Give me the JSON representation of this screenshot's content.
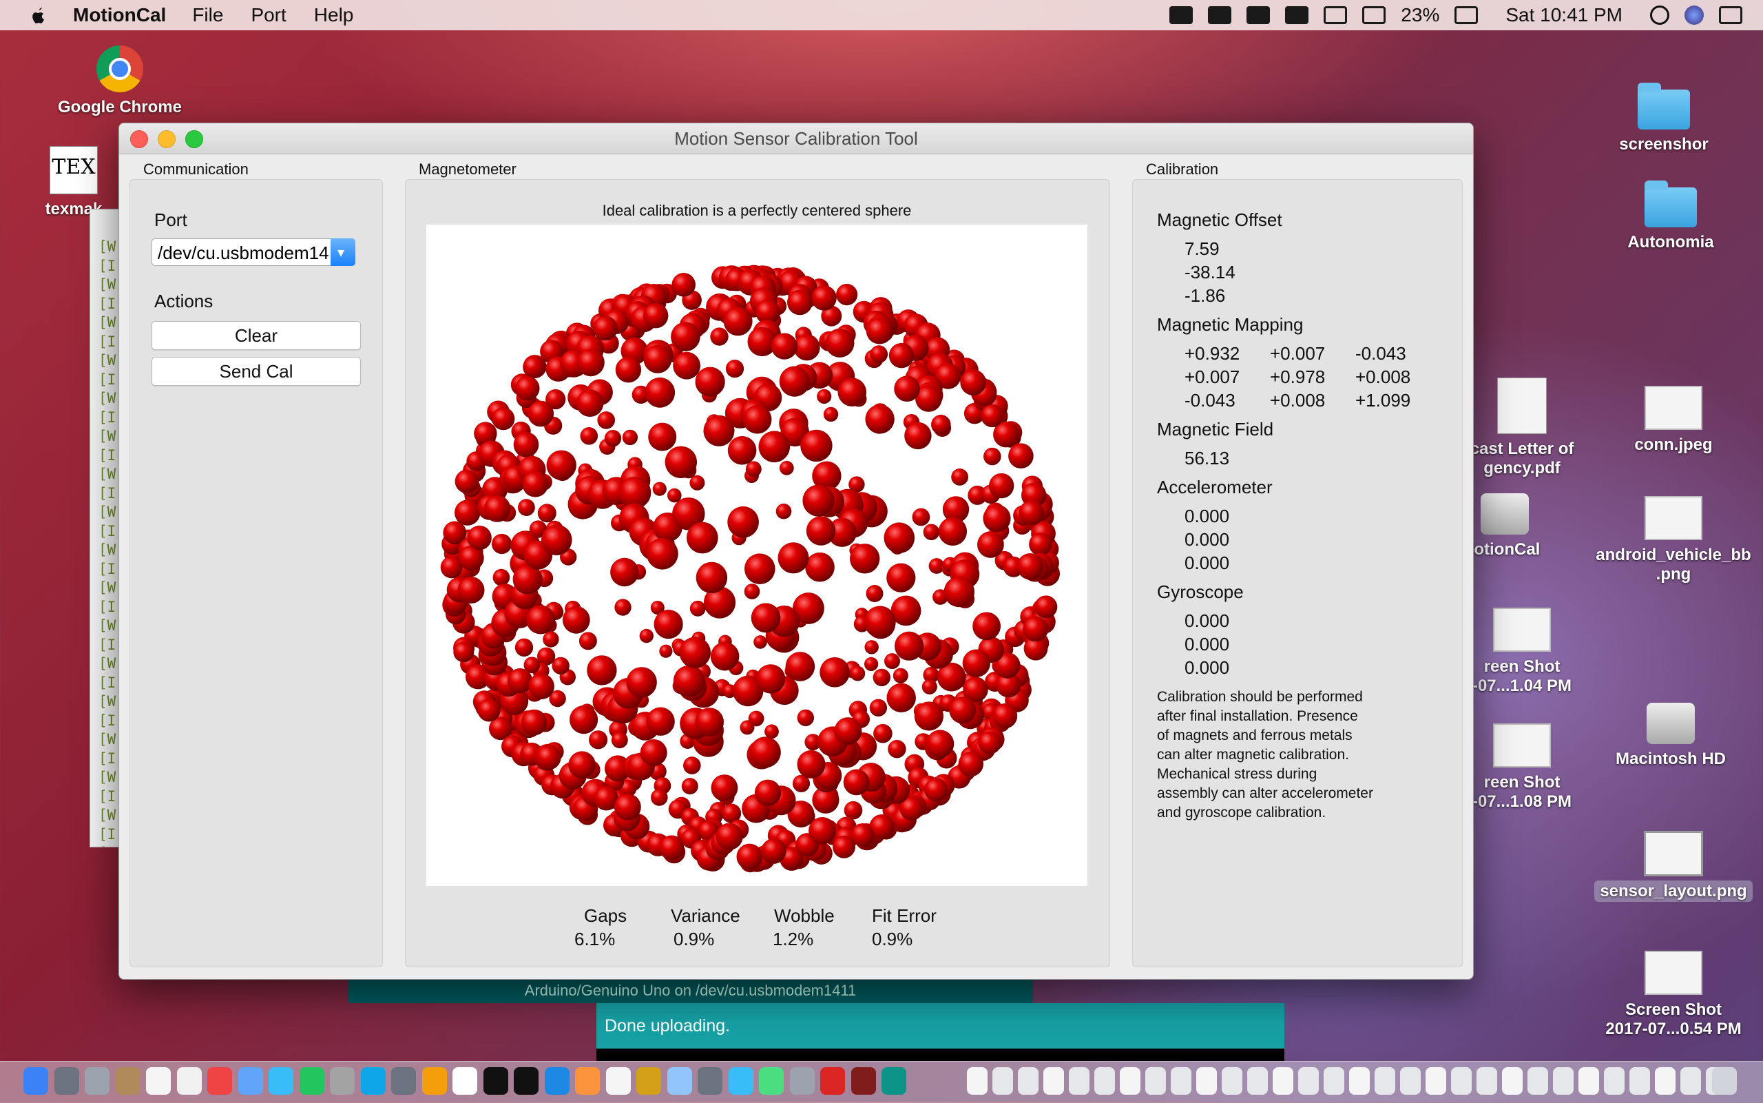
{
  "menubar": {
    "app_name": "MotionCal",
    "menus": [
      "File",
      "Port",
      "Help"
    ],
    "battery": "23%",
    "clock": "Sat 10:41 PM"
  },
  "desktop": {
    "chrome_label": "Google Chrome",
    "texmaker_label": "texmak",
    "screenshot_folder": "screenshor",
    "autonomia_folder": "Autonomia",
    "letter_pdf_line1": "cast Letter of",
    "letter_pdf_line2": "gency.pdf",
    "conn_jpeg": "conn.jpeg",
    "motioncal_dmg": "lotionCal",
    "android_png_line1": "android_vehicle_bb",
    "android_png_line2": ".png",
    "shot1_line1": "reen Shot",
    "shot1_line2": "-07...1.04 PM",
    "shot2_line1": "reen Shot",
    "shot2_line2": "-07...1.08 PM",
    "macintosh_hd": "Macintosh HD",
    "sensor_layout": "sensor_layout.png",
    "shot3_line1": "Screen Shot",
    "shot3_line2": "2017-07...0.54 PM"
  },
  "terminal": {
    "lines": [
      "[W",
      "[I",
      "[W",
      "[I",
      "[W",
      "[I",
      "[W",
      "[I",
      "[W",
      "[I",
      "[W",
      "[I",
      "[W",
      "[I",
      "[W",
      "[I",
      "[W",
      "[I",
      "[W",
      "[I",
      "[W",
      "[I",
      "[W",
      "[I",
      "[W",
      "[I",
      "[W",
      "[I",
      "[W",
      "[I",
      "[W",
      "[I",
      "[W"
    ]
  },
  "arduino": {
    "status": "Arduino/Genuino Uno on /dev/cu.usbmodem1411",
    "console": "Done uploading."
  },
  "window": {
    "title": "Motion Sensor Calibration Tool",
    "communication": {
      "group_title": "Communication",
      "port_label": "Port",
      "port_value": "/dev/cu.usbmodem14",
      "actions_label": "Actions",
      "clear_button": "Clear",
      "send_cal_button": "Send Cal"
    },
    "magnetometer": {
      "group_title": "Magnetometer",
      "caption": "Ideal calibration is a perfectly centered sphere",
      "stats": [
        {
          "label": "Gaps",
          "value": "6.1%"
        },
        {
          "label": "Variance",
          "value": "0.9%"
        },
        {
          "label": "Wobble",
          "value": "1.2%"
        },
        {
          "label": "Fit Error",
          "value": "0.9%"
        }
      ]
    },
    "calibration": {
      "group_title": "Calibration",
      "offset_label": "Magnetic Offset",
      "offset": [
        "7.59",
        "-38.14",
        "-1.86"
      ],
      "mapping_label": "Magnetic Mapping",
      "mapping": [
        [
          "+0.932",
          "+0.007",
          "-0.043"
        ],
        [
          "+0.007",
          "+0.978",
          "+0.008"
        ],
        [
          "-0.043",
          "+0.008",
          "+1.099"
        ]
      ],
      "field_label": "Magnetic Field",
      "field": "56.13",
      "accel_label": "Accelerometer",
      "accel": [
        "0.000",
        "0.000",
        "0.000"
      ],
      "gyro_label": "Gyroscope",
      "gyro": [
        "0.000",
        "0.000",
        "0.000"
      ],
      "note_lines": [
        "Calibration should be performed",
        "after final installation.  Presence",
        "of magnets and ferrous metals",
        "can alter magnetic calibration.",
        "Mechanical stress during",
        "assembly can alter accelerometer",
        "and gyroscope calibration."
      ]
    }
  },
  "colors": {
    "sphere_red": "#e00000",
    "window_bg": "#ececec",
    "arduino_teal": "#17a1a5"
  }
}
